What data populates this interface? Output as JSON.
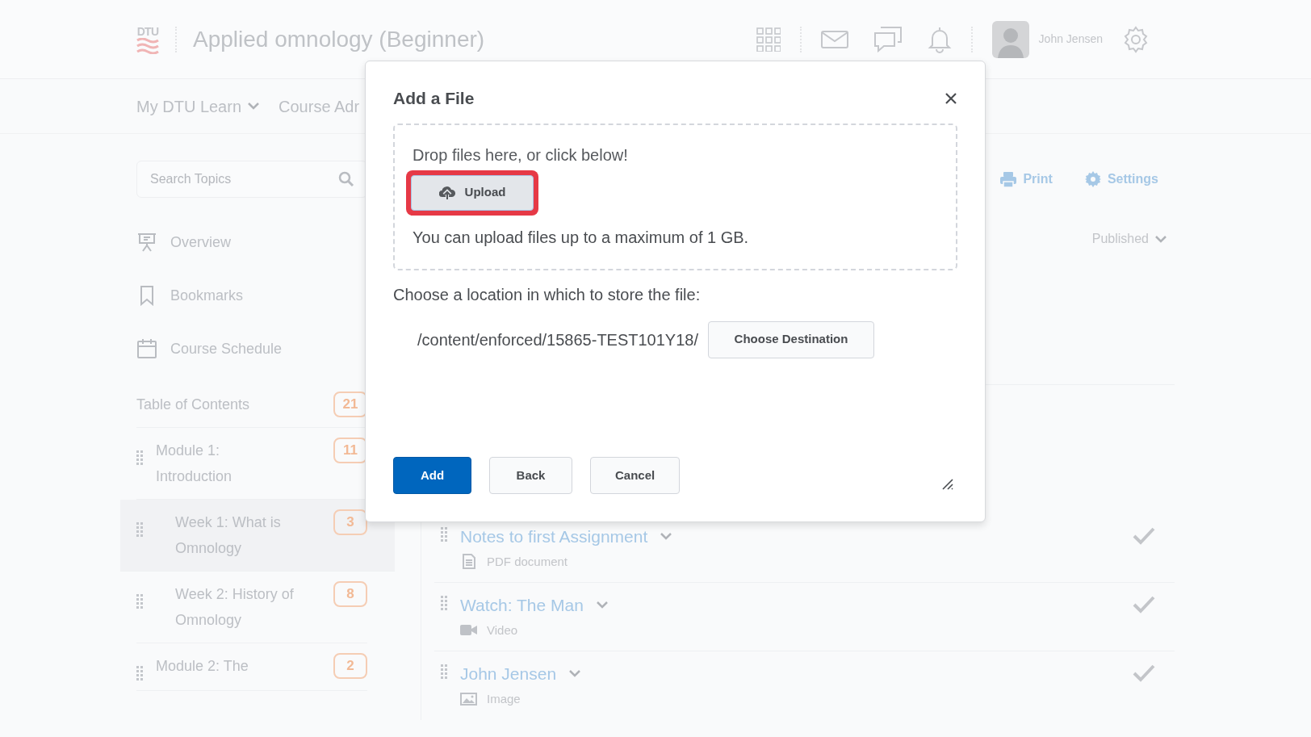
{
  "header": {
    "logo_text": "DTU",
    "title": "Applied omnology (Beginner)",
    "user_name": "John Jensen"
  },
  "nav": [
    {
      "label": "My DTU Learn",
      "dropdown": true
    },
    {
      "label": "Course Adr",
      "dropdown": false
    }
  ],
  "sidebar": {
    "search": {
      "placeholder": "Search Topics"
    },
    "links": [
      {
        "label": "Overview"
      },
      {
        "label": "Bookmarks"
      },
      {
        "label": "Course Schedule"
      }
    ],
    "toc": {
      "label": "Table of Contents",
      "count": "21"
    },
    "modules": [
      {
        "title": "Module 1: Introduction",
        "count": "11",
        "selected": false,
        "children": [
          {
            "title": "Week 1: What is Omnology",
            "count": "3",
            "selected": true
          },
          {
            "title": "Week 2: History of Omnology",
            "count": "8",
            "selected": false
          }
        ]
      },
      {
        "title": "Module 2: The",
        "count": "2",
        "selected": false
      }
    ]
  },
  "content": {
    "toolbar": [
      "Print",
      "Settings"
    ],
    "status_filter": "Published",
    "topics": [
      {
        "title": "Notes to first Assignment",
        "type_label": "PDF document",
        "kind": "pdf",
        "checked": true
      },
      {
        "title": "Watch: The Man",
        "type_label": "Video",
        "kind": "video",
        "checked": true
      },
      {
        "title": "John Jensen",
        "type_label": "Image",
        "kind": "image",
        "checked": true
      }
    ]
  },
  "dialog": {
    "title": "Add a File",
    "drop_hint": "Drop files here, or click below!",
    "upload_button": {
      "label": "Upload",
      "highlighted": true
    },
    "limit_note": "You can upload files up to a maximum of 1 GB.",
    "location_label": "Choose a location in which to store the file:",
    "path": "/content/enforced/15865-TEST101Y18/",
    "choose_button": "Choose Destination",
    "buttons": [
      {
        "label": "Add",
        "kind": "primary"
      },
      {
        "label": "Back",
        "kind": "secondary"
      },
      {
        "label": "Cancel",
        "kind": "secondary"
      }
    ]
  }
}
